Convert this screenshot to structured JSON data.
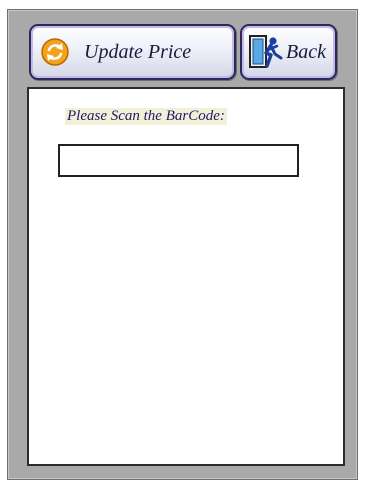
{
  "toolbar": {
    "update_label": "Update Price",
    "update_icon": "refresh-icon",
    "back_label": "Back",
    "back_icon": "exit-door-icon"
  },
  "form": {
    "prompt": "Please Scan the BarCode:",
    "barcode_value": ""
  },
  "colors": {
    "frame": "#a9a9a9",
    "button_border": "#2a2a5a",
    "button_highlight": "#c9b7ea",
    "label_text": "#1b1b6a",
    "icon_orange": "#f2a21b"
  }
}
